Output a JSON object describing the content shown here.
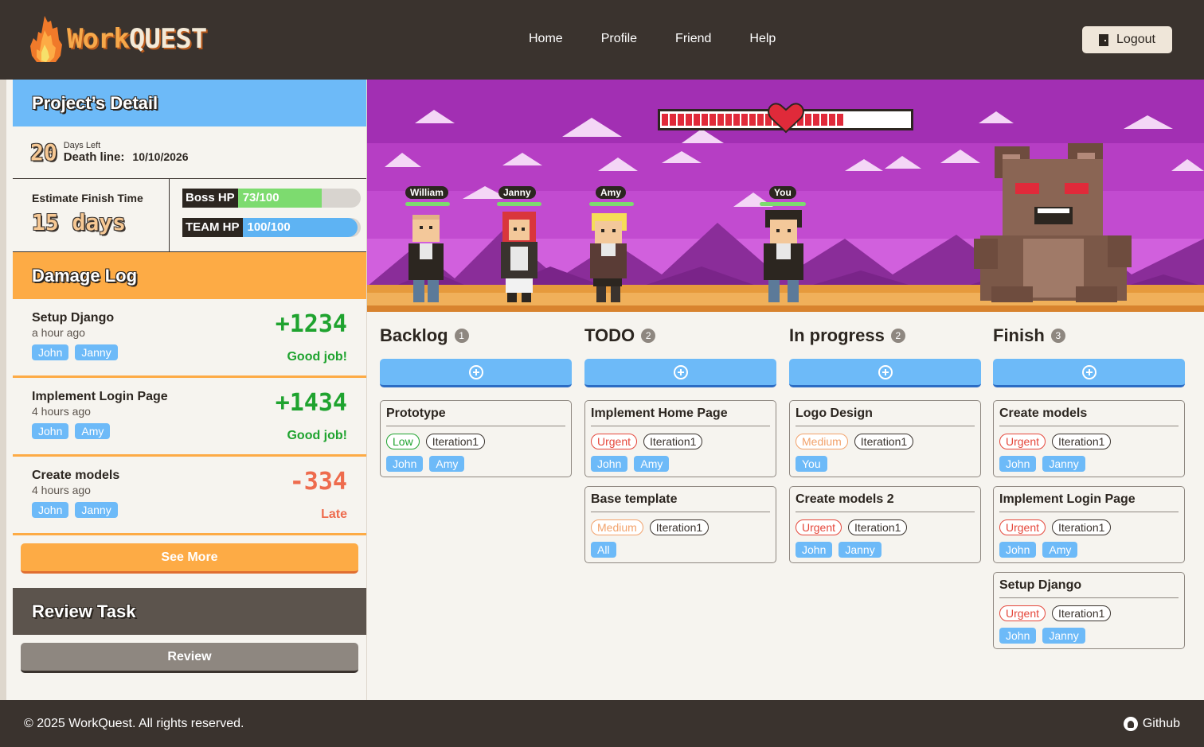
{
  "brand": {
    "name_part1": "Work",
    "name_part2": "QUEST"
  },
  "nav": {
    "items": [
      "Home",
      "Profile",
      "Friend",
      "Help"
    ],
    "logout_label": "Logout"
  },
  "project": {
    "heading": "Project’s Detail",
    "days_left_number": "20",
    "days_left_label": "Days Left",
    "deadline_label": "Death line:",
    "deadline_value": "10/10/2026",
    "estimate_label": "Estimate Finish Time",
    "estimate_value": "15 days",
    "boss_hp_label": "Boss HP",
    "boss_hp_value": "73/100",
    "boss_hp_fraction": 0.73,
    "team_hp_label": "TEAM HP",
    "team_hp_value": "100/100",
    "team_hp_fraction": 1.0
  },
  "damage_log": {
    "heading": "Damage Log",
    "entries": [
      {
        "title": "Setup Django",
        "time": "a hour ago",
        "people": [
          "John",
          "Janny"
        ],
        "score": "+1234",
        "verdict": "Good job!",
        "type": "pos"
      },
      {
        "title": "Implement Login Page",
        "time": "4 hours ago",
        "people": [
          "John",
          "Amy"
        ],
        "score": "+1434",
        "verdict": "Good job!",
        "type": "pos"
      },
      {
        "title": "Create models",
        "time": "4 hours ago",
        "people": [
          "John",
          "Janny"
        ],
        "score": "-334",
        "verdict": "Late",
        "type": "neg"
      }
    ],
    "see_more_label": "See More"
  },
  "review": {
    "heading": "Review Task",
    "button_label": "Review"
  },
  "scene": {
    "characters": [
      "William",
      "Janny",
      "Amy",
      "You"
    ],
    "boss_hp_fraction": 0.73
  },
  "board": {
    "columns": [
      {
        "title": "Backlog",
        "count": "1",
        "cards": [
          {
            "title": "Prototype",
            "priority": "Low",
            "priority_type": "low",
            "iteration": "Iteration1",
            "people": [
              "John",
              "Amy"
            ]
          }
        ]
      },
      {
        "title": "TODO",
        "count": "2",
        "cards": [
          {
            "title": "Implement Home Page",
            "priority": "Urgent",
            "priority_type": "urgent",
            "iteration": "Iteration1",
            "people": [
              "John",
              "Amy"
            ]
          },
          {
            "title": "Base template",
            "priority": "Medium",
            "priority_type": "medium",
            "iteration": "Iteration1",
            "people": [
              "All"
            ]
          }
        ]
      },
      {
        "title": "In progress",
        "count": "2",
        "cards": [
          {
            "title": "Logo Design",
            "priority": "Medium",
            "priority_type": "medium",
            "iteration": "Iteration1",
            "people": [
              "You"
            ]
          },
          {
            "title": "Create models 2",
            "priority": "Urgent",
            "priority_type": "urgent",
            "iteration": "Iteration1",
            "people": [
              "John",
              "Janny"
            ]
          }
        ]
      },
      {
        "title": "Finish",
        "count": "3",
        "cards": [
          {
            "title": "Create models",
            "priority": "Urgent",
            "priority_type": "urgent",
            "iteration": "Iteration1",
            "people": [
              "John",
              "Janny"
            ]
          },
          {
            "title": "Implement Login Page",
            "priority": "Urgent",
            "priority_type": "urgent",
            "iteration": "Iteration1",
            "people": [
              "John",
              "Amy"
            ]
          },
          {
            "title": "Setup Django",
            "priority": "Urgent",
            "priority_type": "urgent",
            "iteration": "Iteration1",
            "people": [
              "John",
              "Janny"
            ]
          }
        ]
      }
    ]
  },
  "footer": {
    "copyright": "© 2025 WorkQuest. All rights reserved.",
    "github_label": "Github"
  },
  "colors": {
    "accent_blue": "#6dbaf8",
    "accent_orange": "#fdab45",
    "dark": "#3a332e",
    "scene_purple": "#a23bb5"
  }
}
